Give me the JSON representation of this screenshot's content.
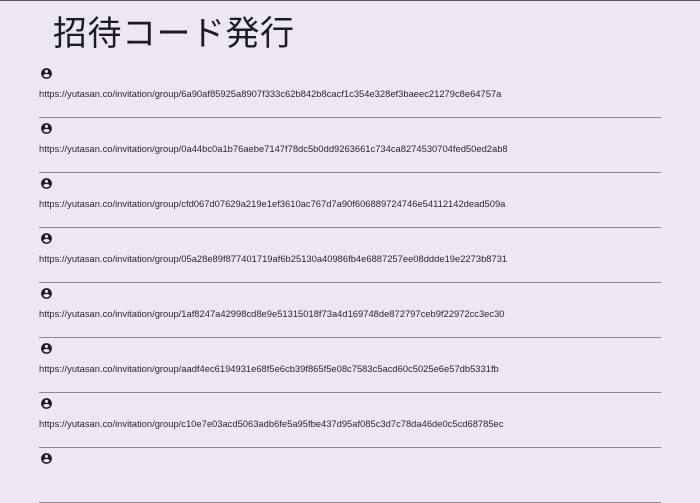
{
  "page": {
    "title": "招待コード発行"
  },
  "icons": {
    "item_icon": "account-circle-icon"
  },
  "colors": {
    "background": "#ede6f5",
    "text": "#1f1b24",
    "divider": "#8e8896"
  },
  "invitations": [
    {
      "url": "https://yutasan.co/invitation/group/6a90af85925a8907f333c62b842b8cacf1c354e328ef3baeec21279c8e64757a"
    },
    {
      "url": "https://yutasan.co/invitation/group/0a44bc0a1b76aebe7147f78dc5b0dd9263661c734ca8274530704fed50ed2ab8"
    },
    {
      "url": "https://yutasan.co/invitation/group/cfd067d07629a219e1ef3610ac767d7a90f606889724746e54112142dead509a"
    },
    {
      "url": "https://yutasan.co/invitation/group/05a28e89f877401719af6b25130a40986fb4e6887257ee08ddde19e2273b8731"
    },
    {
      "url": "https://yutasan.co/invitation/group/1af8247a42998cd8e9e51315018f73a4d169748de872797ceb9f22972cc3ec30"
    },
    {
      "url": "https://yutasan.co/invitation/group/aadf4ec6194931e68f5e6cb39f865f5e08c7583c5acd60c5025e6e57db5331fb"
    },
    {
      "url": "https://yutasan.co/invitation/group/c10e7e03acd5063adb6fe5a95fbe437d95af085c3d7c78da46de0c5cd68785ec"
    }
  ]
}
